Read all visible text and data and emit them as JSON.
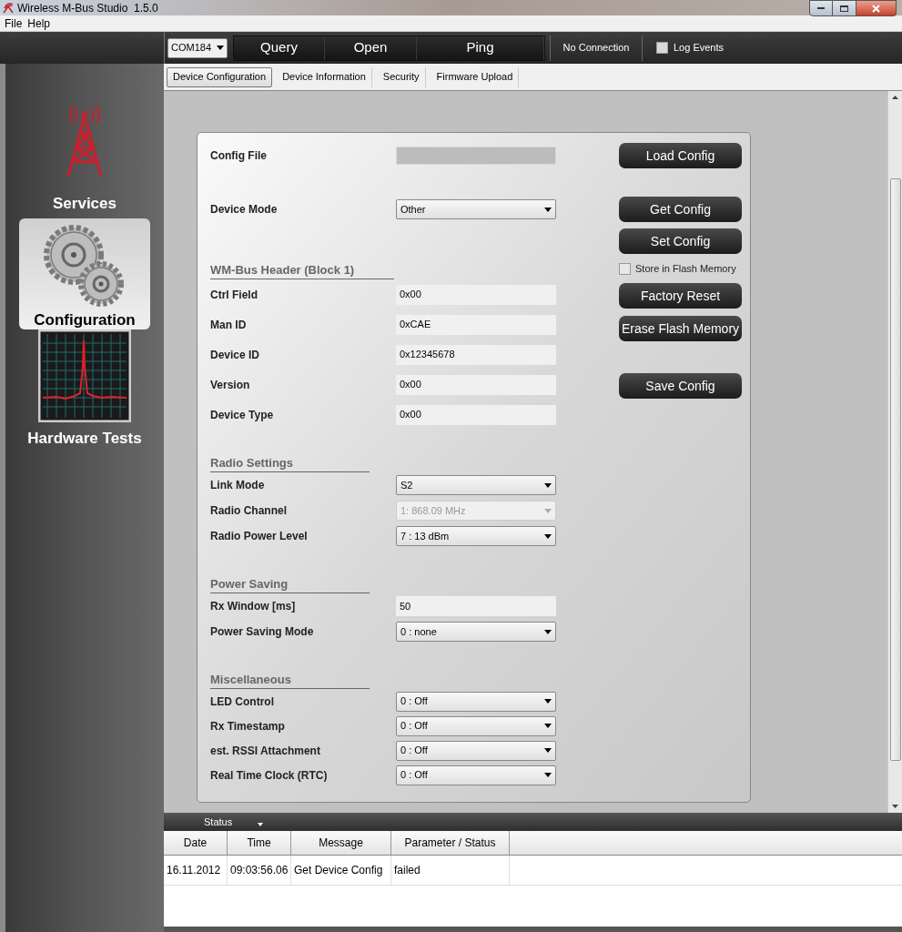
{
  "window": {
    "title": "Wireless M-Bus Studio  1.5.0"
  },
  "menu": [
    {
      "label": "File"
    },
    {
      "label": "Help"
    }
  ],
  "toolbar": {
    "port": {
      "value": "COM184"
    },
    "buttons": [
      "Query",
      "Open",
      "Ping"
    ],
    "connection": "No Connection",
    "log_events": {
      "label": "Log Events",
      "checked": false
    }
  },
  "tabs": [
    {
      "label": "Device Configuration",
      "selected": true
    },
    {
      "label": "Device Information",
      "selected": false
    },
    {
      "label": "Security",
      "selected": false
    },
    {
      "label": "Firmware Upload",
      "selected": false
    }
  ],
  "sidebar": [
    {
      "kind": "tower",
      "label": "Services",
      "selected": false
    },
    {
      "kind": "gears",
      "label": "Configuration",
      "selected": true
    },
    {
      "kind": "spectrum",
      "label": "Hardware Tests",
      "selected": false
    }
  ],
  "sections": [
    {
      "rows": [
        {
          "kind": "file",
          "label": "Config File",
          "disabled": false
        },
        {
          "kind": "select",
          "label": "Device Mode",
          "value": "Other",
          "disabled": false
        }
      ]
    },
    {
      "heading": "WM-Bus Header (Block 1)",
      "rows": [
        {
          "kind": "text",
          "label": "Ctrl Field",
          "value": "0x00",
          "disabled": false
        },
        {
          "kind": "text",
          "label": "Man ID",
          "value": "0xCAE",
          "disabled": false
        },
        {
          "kind": "text",
          "label": "Device ID",
          "value": "0x12345678",
          "disabled": false
        },
        {
          "kind": "text",
          "label": "Version",
          "value": "0x00",
          "disabled": false
        },
        {
          "kind": "text",
          "label": "Device Type",
          "value": "0x00",
          "disabled": false
        }
      ]
    },
    {
      "heading": "Radio Settings",
      "rows": [
        {
          "kind": "select",
          "label": "Link Mode",
          "value": "S2",
          "disabled": false
        },
        {
          "kind": "select",
          "label": "Radio Channel",
          "value": "1: 868.09 MHz",
          "disabled": true
        },
        {
          "kind": "select",
          "label": "Radio Power Level",
          "value": "7 : 13 dBm",
          "disabled": false
        }
      ]
    },
    {
      "heading": "Power Saving",
      "rows": [
        {
          "kind": "text",
          "label": "Rx Window [ms]",
          "value": "50",
          "disabled": false
        },
        {
          "kind": "select",
          "label": "Power Saving Mode",
          "value": "0 : none",
          "disabled": false
        }
      ]
    },
    {
      "heading": "Miscellaneous",
      "rows": [
        {
          "kind": "select",
          "label": "LED Control",
          "value": "0 : Off",
          "disabled": false
        },
        {
          "kind": "select",
          "label": "Rx Timestamp",
          "value": "0 : Off",
          "disabled": false
        },
        {
          "kind": "select",
          "label": "est. RSSI Attachment",
          "value": "0 : Off",
          "disabled": false
        },
        {
          "kind": "select",
          "label": "Real Time Clock (RTC)",
          "value": "0 : Off",
          "disabled": false
        }
      ]
    }
  ],
  "actions": [
    {
      "kind": "button",
      "label": "Load Config"
    },
    {
      "kind": "button",
      "label": "Get Config"
    },
    {
      "kind": "button",
      "label": "Set Config"
    },
    {
      "kind": "checkbox",
      "label": "Store in Flash Memory",
      "checked": false
    },
    {
      "kind": "button",
      "label": "Factory Reset"
    },
    {
      "kind": "button",
      "label": "Erase Flash Memory"
    },
    {
      "kind": "button",
      "label": "Save Config"
    }
  ],
  "status_panel": {
    "title": "Status",
    "columns": [
      "Date",
      "Time",
      "Message",
      "Parameter / Status"
    ],
    "rows": [
      [
        "16.11.2012",
        "09:03:56.06",
        "Get Device Config",
        "failed"
      ]
    ]
  }
}
